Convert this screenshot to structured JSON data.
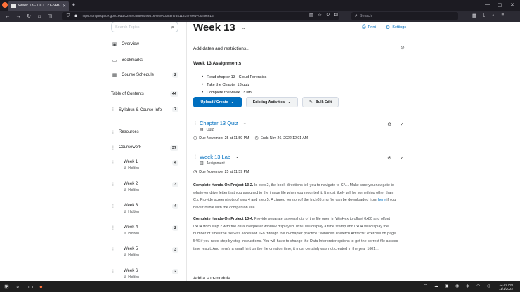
{
  "browser": {
    "tab_title": "Week 13 - CCT121-56BD: Computer Forensics",
    "url": "https://brightspace.gpcc.edu/d2l/le/content/96616/viewContent/5411834/View?ou=96616",
    "search_placeholder": "Search"
  },
  "sidebar": {
    "search_placeholder": "Search Topics",
    "items": [
      {
        "label": "Overview",
        "icon": "overview-icon"
      },
      {
        "label": "Bookmarks",
        "icon": "bookmark-icon"
      },
      {
        "label": "Course Schedule",
        "icon": "calendar-icon",
        "badge": "2"
      }
    ],
    "toc": {
      "label": "Table of Contents",
      "badge": "44"
    },
    "tree": [
      {
        "label": "Syllabus & Course Info",
        "badge": "7"
      },
      {
        "label": "Resources",
        "badge": ""
      },
      {
        "label": "Coursework",
        "badge": "37"
      }
    ],
    "weeks": [
      {
        "label": "Week 1",
        "badge": "4",
        "status": "Hidden"
      },
      {
        "label": "Week 2",
        "badge": "3",
        "status": "Hidden"
      },
      {
        "label": "Week 3",
        "badge": "4",
        "status": "Hidden"
      },
      {
        "label": "Week 4",
        "badge": "2",
        "status": "Hidden"
      },
      {
        "label": "Week 5",
        "badge": "3",
        "status": "Hidden"
      },
      {
        "label": "Week 6",
        "badge": "2",
        "status": "Hidden"
      }
    ]
  },
  "main": {
    "title": "Week 13",
    "print_label": "Print",
    "settings_label": "Settings",
    "add_dates": "Add dates and restrictions...",
    "section_title": "Week 13 Assignments",
    "bullets": [
      "Read chapter 13 - Cloud Forensics",
      "Take the Chapter 13 quiz",
      "Complete the week 13 lab"
    ],
    "buttons": {
      "upload": "Upload / Create",
      "existing": "Existing Activities",
      "bulk": "Bulk Edit"
    },
    "quiz": {
      "title": "Chapter 13 Quiz",
      "type": "Quiz",
      "due": "Due November 25 at 11:59 PM",
      "ends": "Ends Nov 26, 2022 12:01 AM"
    },
    "lab": {
      "title": "Week 13 Lab",
      "type": "Assignment",
      "due": "Due November 25 at 11:59 PM"
    },
    "desc1": {
      "bold": "Complete Hands-On Project 13-2.",
      "text_a": " In step 2, the book directions tell you to navigate to C:\\... Make sure you navigate to whatever drive letter that you assigned to the image file when you mounted it. It most likely will be something other than C:\\. Provide screenshots of step 4 and step 5. A zipped version of the fnch05.img file can be downloaded from ",
      "link": "here",
      "text_b": " if you have trouble with the companion site."
    },
    "desc2": {
      "bold": "Complete Hands-On Project 13-4.",
      "text": " Provide separate screenshots of the file open in WinHex to offset 0x80 and offset 0xD4 from step 2 with the data interpreter window displayed. 0x80 will display a time stamp and 0xD4 will display the number of times the file was accessed. Go through the in-chapter practice \"Windows Prefetch Artifacts\" exercise on page 546 if you need step by step instructions. You will have to change the Data Interpreter options to get the correct file access time result. And here's a small hint on the file creation time; it most certainly was not created in the year 1601..."
    },
    "add_submodule": "Add a sub-module..."
  },
  "taskbar": {
    "time": "12:07 PM",
    "date": "11/1/2022"
  },
  "colors": {
    "accent": "#006fbf",
    "tab_bg": "#1c1b22",
    "toolbar_bg": "#2b2a33",
    "taskbar_bg": "#1f1f1f"
  }
}
